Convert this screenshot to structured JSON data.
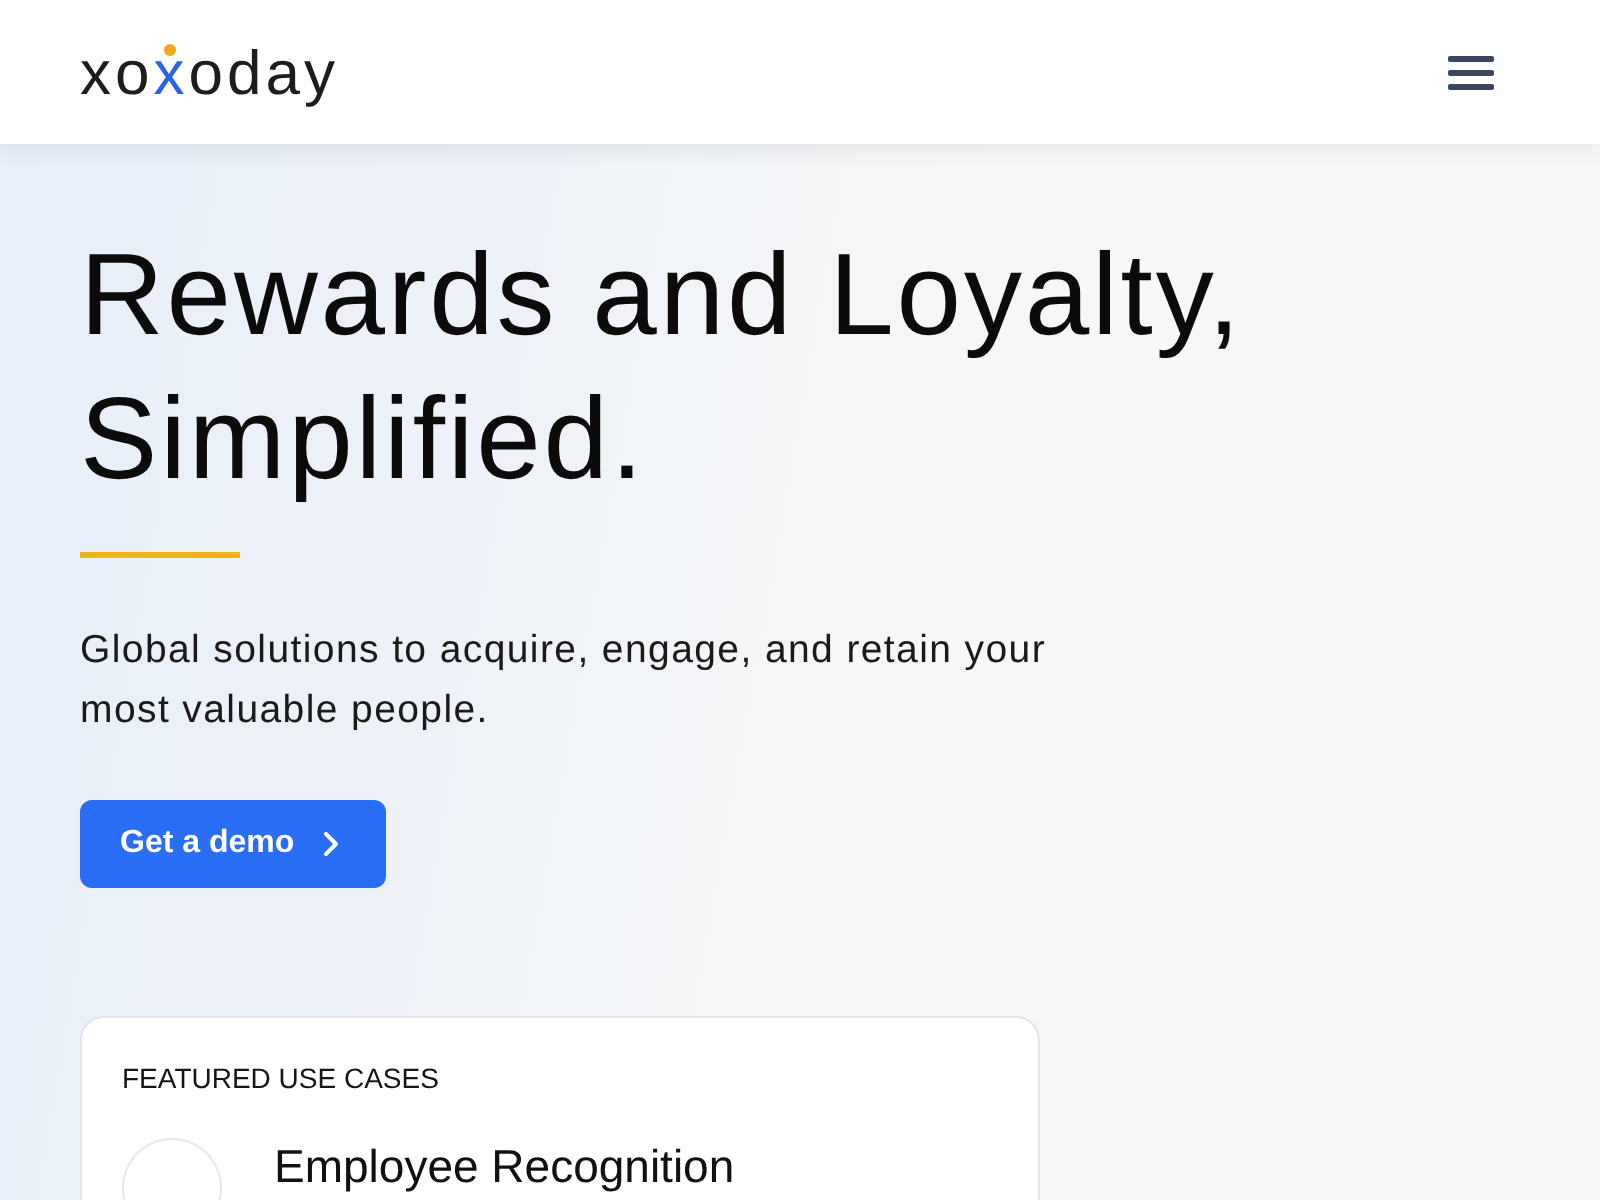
{
  "header": {
    "logo": "xoxoday"
  },
  "hero": {
    "title": "Rewards and Loyalty, Simplified.",
    "subtitle": "Global solutions to acquire, engage, and retain your most valuable people.",
    "cta": "Get a demo"
  },
  "featured": {
    "heading": "FEATURED USE CASES",
    "items": [
      {
        "title": "Employee Recognition"
      }
    ]
  }
}
